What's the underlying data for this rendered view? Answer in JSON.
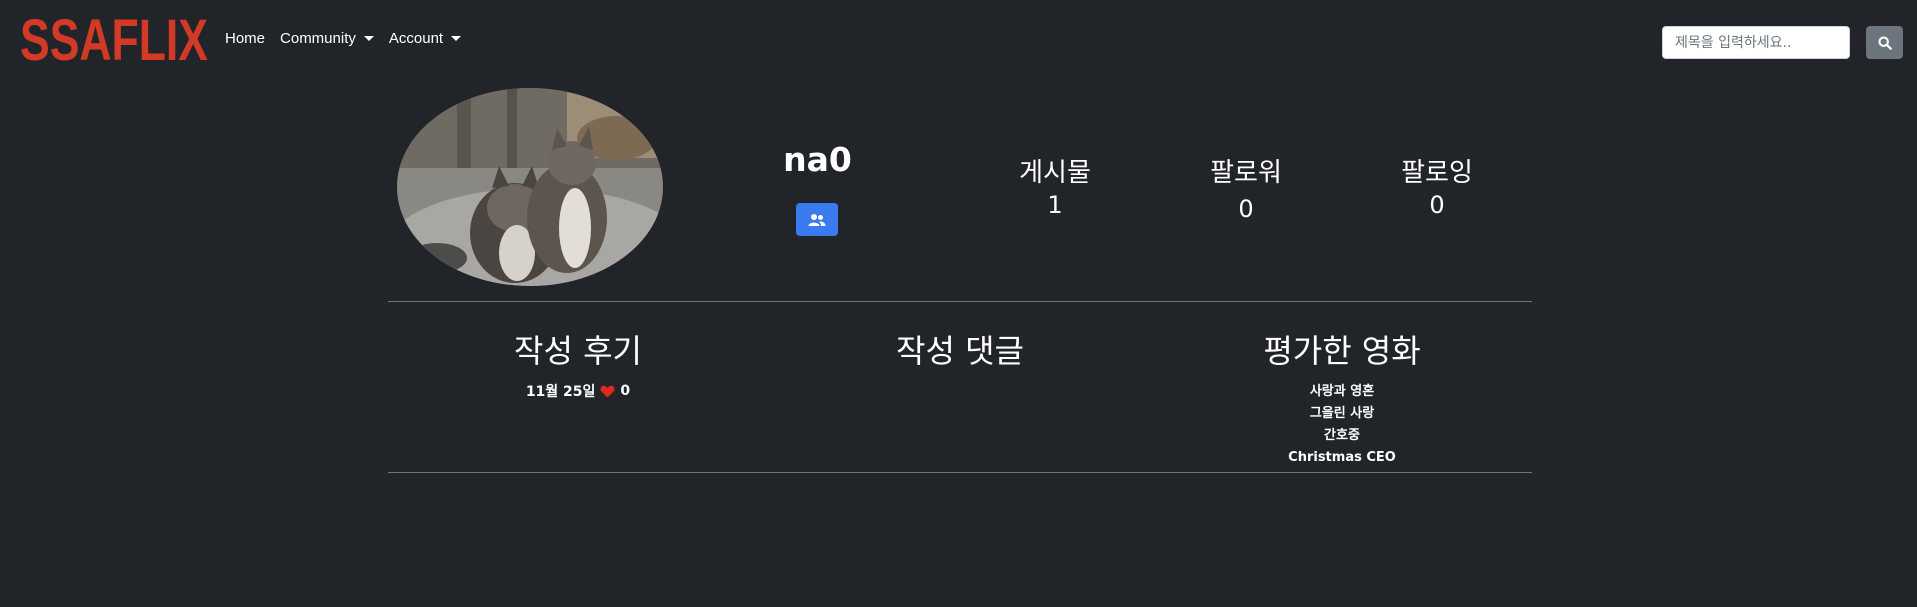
{
  "navbar": {
    "logo_text": "SSAFLIX",
    "links": [
      {
        "label": "Home",
        "dropdown": false
      },
      {
        "label": "Community",
        "dropdown": true
      },
      {
        "label": "Account",
        "dropdown": true
      }
    ],
    "search_placeholder": "제목을 입력하세요..",
    "search_icon": "search-icon"
  },
  "profile": {
    "username": "na0",
    "follow_icon": "users-icon",
    "stats": [
      {
        "label": "게시물",
        "value": "1"
      },
      {
        "label": "팔로워",
        "value": "0"
      },
      {
        "label": "팔로잉",
        "value": "0"
      }
    ]
  },
  "sections": {
    "reviews": {
      "title": "작성 후기",
      "items": [
        {
          "date": "11월 25일",
          "likes": "0",
          "like_icon": "heart-icon"
        }
      ]
    },
    "comments": {
      "title": "작성 댓글",
      "items": []
    },
    "rated_movies": {
      "title": "평가한 영화",
      "items": [
        "사랑과 영혼",
        "그을린 사랑",
        "간호중",
        "Christmas CEO"
      ]
    }
  },
  "colors": {
    "background": "#212529",
    "logo": "#d33a26",
    "follow_button": "#3a7cf0",
    "search_button": "#6c757d",
    "heart": "#e0291a"
  }
}
